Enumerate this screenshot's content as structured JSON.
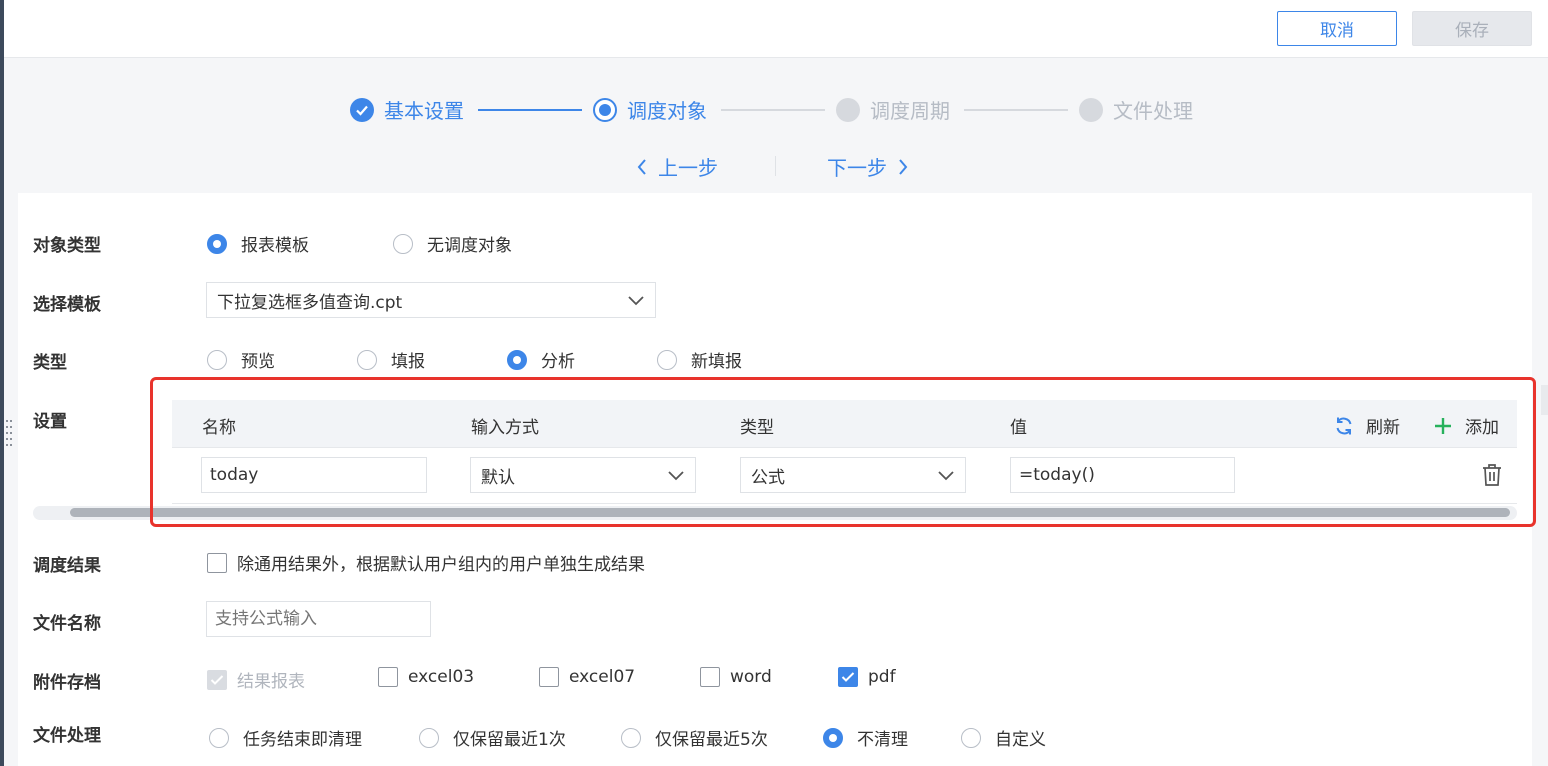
{
  "header": {
    "cancel_label": "取消",
    "save_label": "保存"
  },
  "steps": [
    {
      "label": "基本设置",
      "state": "done"
    },
    {
      "label": "调度对象",
      "state": "current"
    },
    {
      "label": "调度周期",
      "state": "pending"
    },
    {
      "label": "文件处理",
      "state": "pending"
    }
  ],
  "nav": {
    "prev_label": "上一步",
    "next_label": "下一步"
  },
  "form": {
    "object_type": {
      "label": "对象类型",
      "options": [
        "报表模板",
        "无调度对象"
      ],
      "selected": "报表模板"
    },
    "template": {
      "label": "选择模板",
      "value": "下拉复选框多值查询.cpt"
    },
    "type": {
      "label": "类型",
      "options": [
        "预览",
        "填报",
        "分析",
        "新填报"
      ],
      "selected": "分析"
    },
    "settings": {
      "label": "设置",
      "columns": [
        "名称",
        "输入方式",
        "类型",
        "值"
      ],
      "refresh_label": "刷新",
      "add_label": "添加",
      "rows": [
        {
          "name": "today",
          "input_mode": "默认",
          "type": "公式",
          "value": "=today()"
        }
      ]
    },
    "result": {
      "label": "调度结果",
      "option": "除通用结果外，根据默认用户组内的用户单独生成结果",
      "checked": false
    },
    "filename": {
      "label": "文件名称",
      "placeholder": "支持公式输入"
    },
    "attachments": {
      "label": "附件存档",
      "options": [
        {
          "label": "结果报表",
          "checked": true,
          "disabled": true
        },
        {
          "label": "excel03",
          "checked": false
        },
        {
          "label": "excel07",
          "checked": false
        },
        {
          "label": "word",
          "checked": false
        },
        {
          "label": "pdf",
          "checked": true
        }
      ]
    },
    "file_handling": {
      "label": "文件处理",
      "options": [
        "任务结束即清理",
        "仅保留最近1次",
        "仅保留最近5次",
        "不清理",
        "自定义"
      ],
      "selected": "不清理"
    }
  },
  "colors": {
    "accent": "#3d86e8",
    "highlight": "#e8332c",
    "add": "#27b15c"
  }
}
